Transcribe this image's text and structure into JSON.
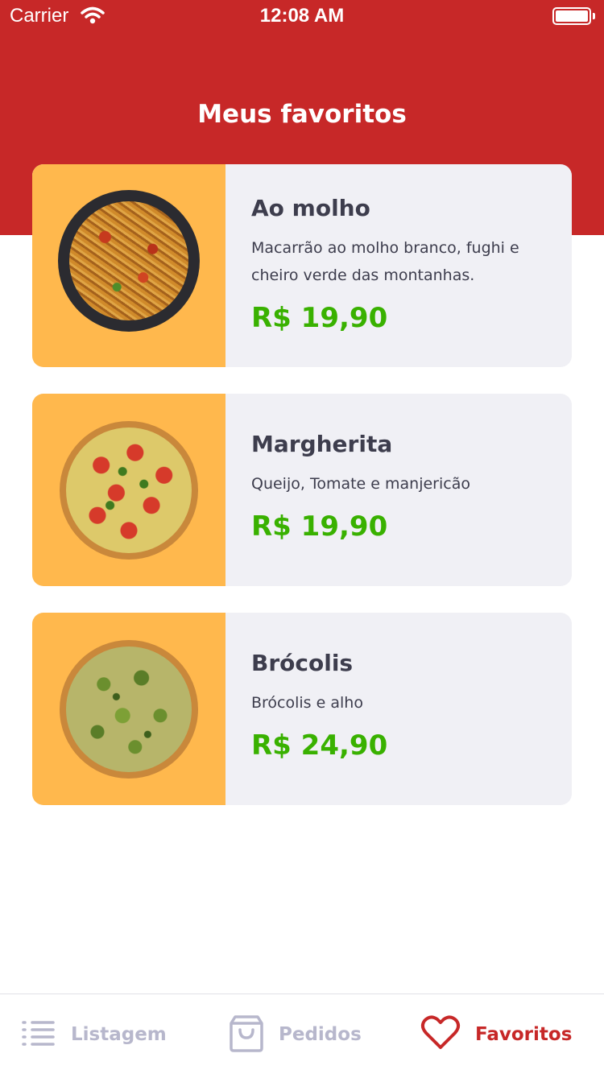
{
  "status_bar": {
    "carrier": "Carrier",
    "time": "12:08 AM"
  },
  "page": {
    "title": "Meus favoritos"
  },
  "favorites": [
    {
      "name": "Ao molho",
      "description": "Macarrão ao molho branco, fughi e cheiro verde das montanhas.",
      "price": "R$ 19,90",
      "image_icon": "pasta-image"
    },
    {
      "name": "Margherita",
      "description": "Queijo, Tomate e manjericão",
      "price": "R$ 19,90",
      "image_icon": "pizza-margherita-image"
    },
    {
      "name": "Brócolis",
      "description": "Brócolis e alho",
      "price": "R$ 24,90",
      "image_icon": "pizza-broccoli-image"
    }
  ],
  "tabbar": {
    "items": [
      {
        "label": "Listagem",
        "icon": "list-icon",
        "active": false
      },
      {
        "label": "Pedidos",
        "icon": "shopping-bag-icon",
        "active": false
      },
      {
        "label": "Favoritos",
        "icon": "heart-icon",
        "active": true
      }
    ]
  },
  "colors": {
    "primary": "#c72828",
    "card_background": "#f0f0f5",
    "image_background": "#ffb84d",
    "price": "#39b100",
    "text": "#3d3d4d",
    "tab_inactive": "#b7b7cc"
  }
}
